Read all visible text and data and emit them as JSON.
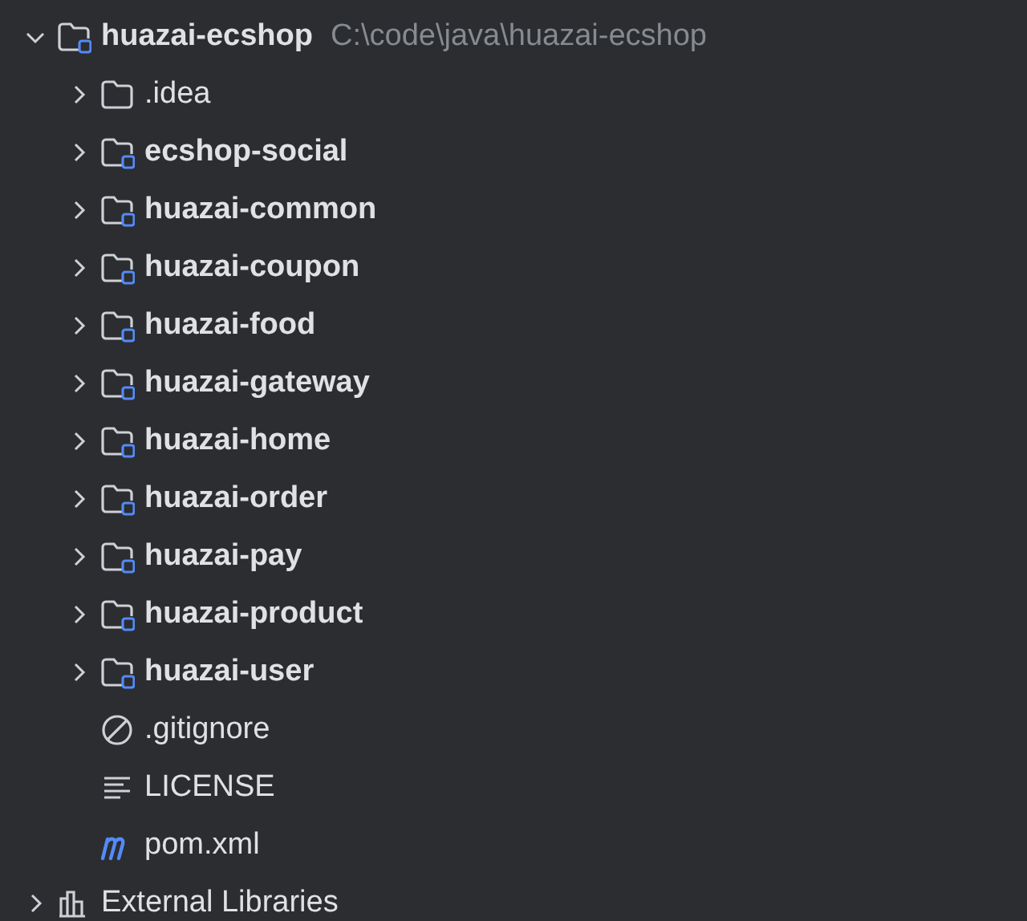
{
  "tree": [
    {
      "kind": "module",
      "label": "huazai-ecshop",
      "path": "C:\\code\\java\\huazai-ecshop",
      "expanded": true,
      "children": [
        {
          "kind": "folder",
          "label": ".idea",
          "expanded": false
        },
        {
          "kind": "module",
          "label": "ecshop-social",
          "expanded": false
        },
        {
          "kind": "module",
          "label": "huazai-common",
          "expanded": false
        },
        {
          "kind": "module",
          "label": "huazai-coupon",
          "expanded": false
        },
        {
          "kind": "module",
          "label": "huazai-food",
          "expanded": false
        },
        {
          "kind": "module",
          "label": "huazai-gateway",
          "expanded": false
        },
        {
          "kind": "module",
          "label": "huazai-home",
          "expanded": false
        },
        {
          "kind": "module",
          "label": "huazai-order",
          "expanded": false
        },
        {
          "kind": "module",
          "label": "huazai-pay",
          "expanded": false
        },
        {
          "kind": "module",
          "label": "huazai-product",
          "expanded": false
        },
        {
          "kind": "module",
          "label": "huazai-user",
          "expanded": false
        },
        {
          "kind": "ignore",
          "label": ".gitignore"
        },
        {
          "kind": "text",
          "label": "LICENSE"
        },
        {
          "kind": "maven",
          "label": "pom.xml"
        }
      ]
    },
    {
      "kind": "libraries",
      "label": "External Libraries",
      "expanded": false
    }
  ]
}
